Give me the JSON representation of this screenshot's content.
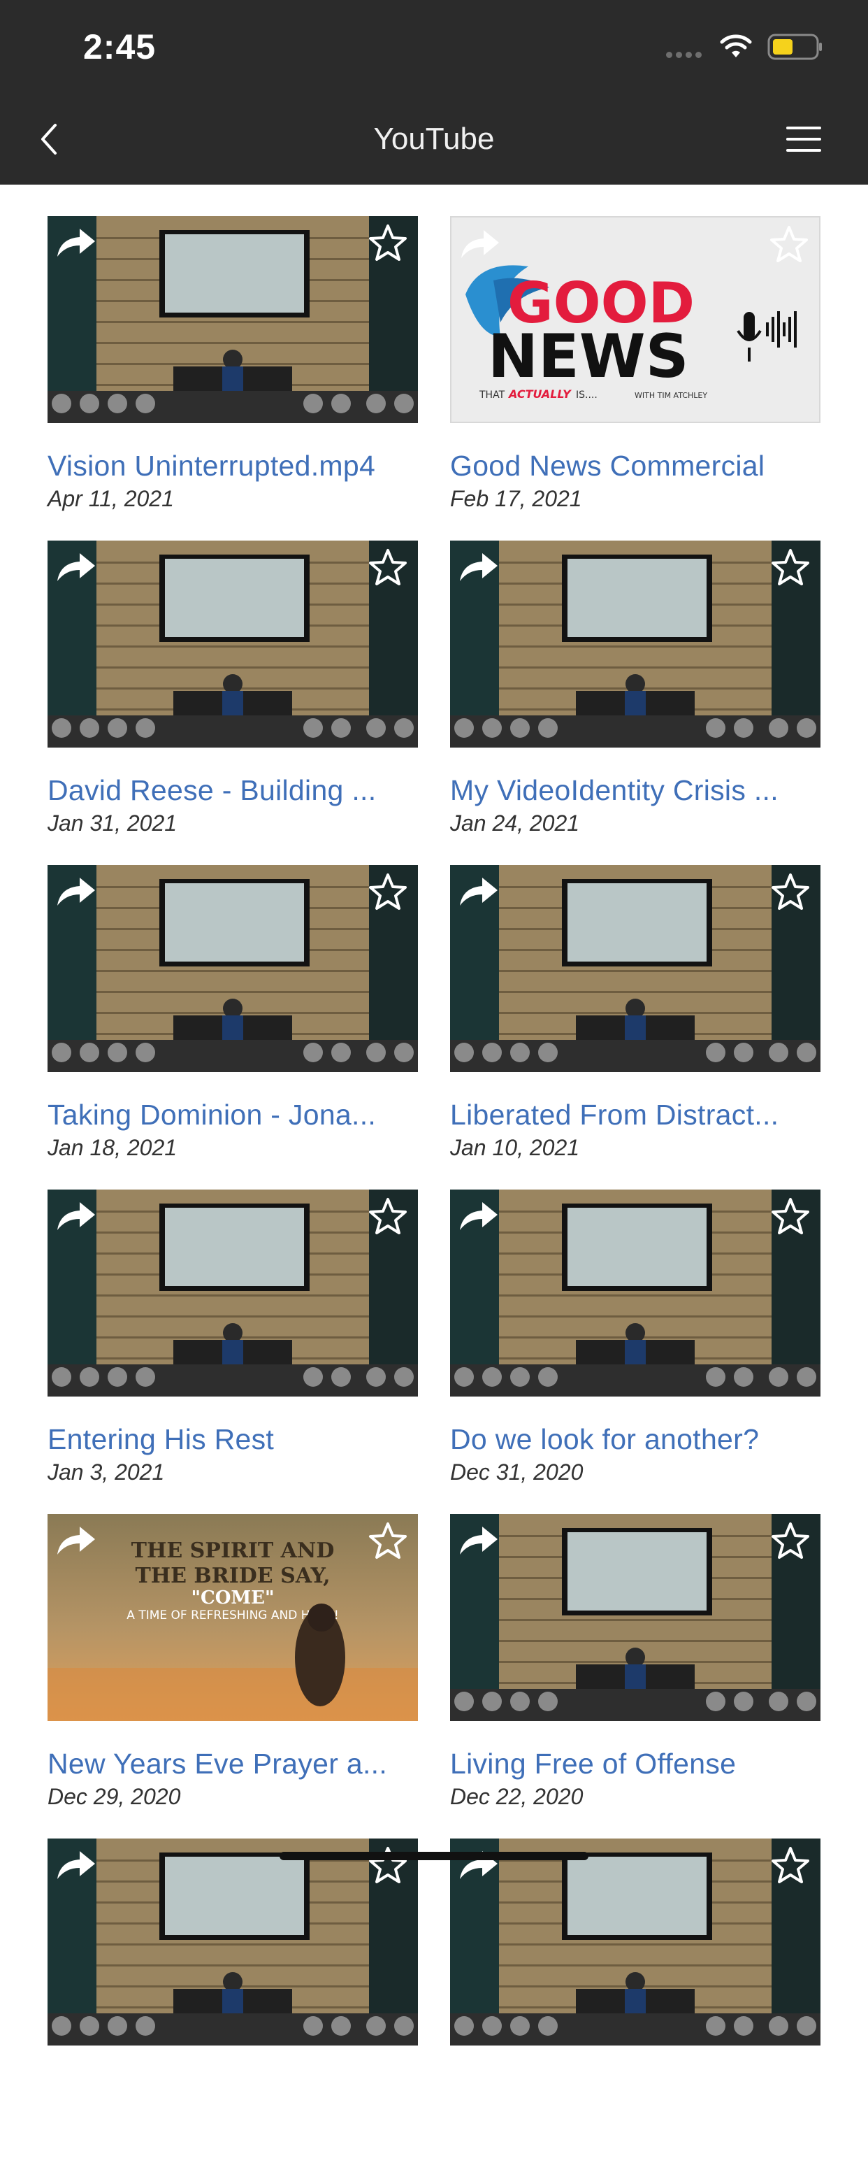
{
  "status": {
    "time": "2:45",
    "battery_color": "#f5d21c"
  },
  "nav": {
    "title": "YouTube"
  },
  "colors": {
    "accent": "#3f6fb8",
    "bar": "#2b2b2b"
  },
  "videos": [
    {
      "title": "Vision Uninterrupted.mp4",
      "date": "Apr 11, 2021",
      "thumb": "stage"
    },
    {
      "title": "Good News Commercial",
      "date": "Feb 17, 2021",
      "thumb": "logo",
      "logo_text": {
        "line1": "GOOD",
        "line2": "NEWS",
        "tagline_a": "THAT",
        "tagline_b": "ACTUALLY",
        "tagline_c": "IS....",
        "byline": "WITH TIM ATCHLEY"
      }
    },
    {
      "title": "David Reese - Building ...",
      "date": "Jan 31, 2021",
      "thumb": "stage"
    },
    {
      "title": "My VideoIdentity Crisis ...",
      "date": "Jan 24, 2021",
      "thumb": "stage"
    },
    {
      "title": "Taking Dominion - Jona...",
      "date": "Jan 18, 2021",
      "thumb": "stage"
    },
    {
      "title": "Liberated From Distract...",
      "date": "Jan 10, 2021",
      "thumb": "stage"
    },
    {
      "title": "Entering His Rest",
      "date": "Jan 3, 2021",
      "thumb": "stage"
    },
    {
      "title": "Do we look for another?",
      "date": "Dec 31, 2020",
      "thumb": "stage"
    },
    {
      "title": "New Years Eve Prayer a...",
      "date": "Dec 29, 2020",
      "thumb": "poster",
      "poster_text": {
        "line1": "THE SPIRIT AND",
        "line2": "THE BRIDE SAY,",
        "line3": "\"COME\"",
        "line4": "A TIME OF REFRESHING AND HOPE!"
      }
    },
    {
      "title": "Living Free of Offense",
      "date": "Dec 22, 2020",
      "thumb": "stage"
    },
    {
      "title": "",
      "date": "",
      "thumb": "stage"
    },
    {
      "title": "",
      "date": "",
      "thumb": "stage"
    }
  ]
}
